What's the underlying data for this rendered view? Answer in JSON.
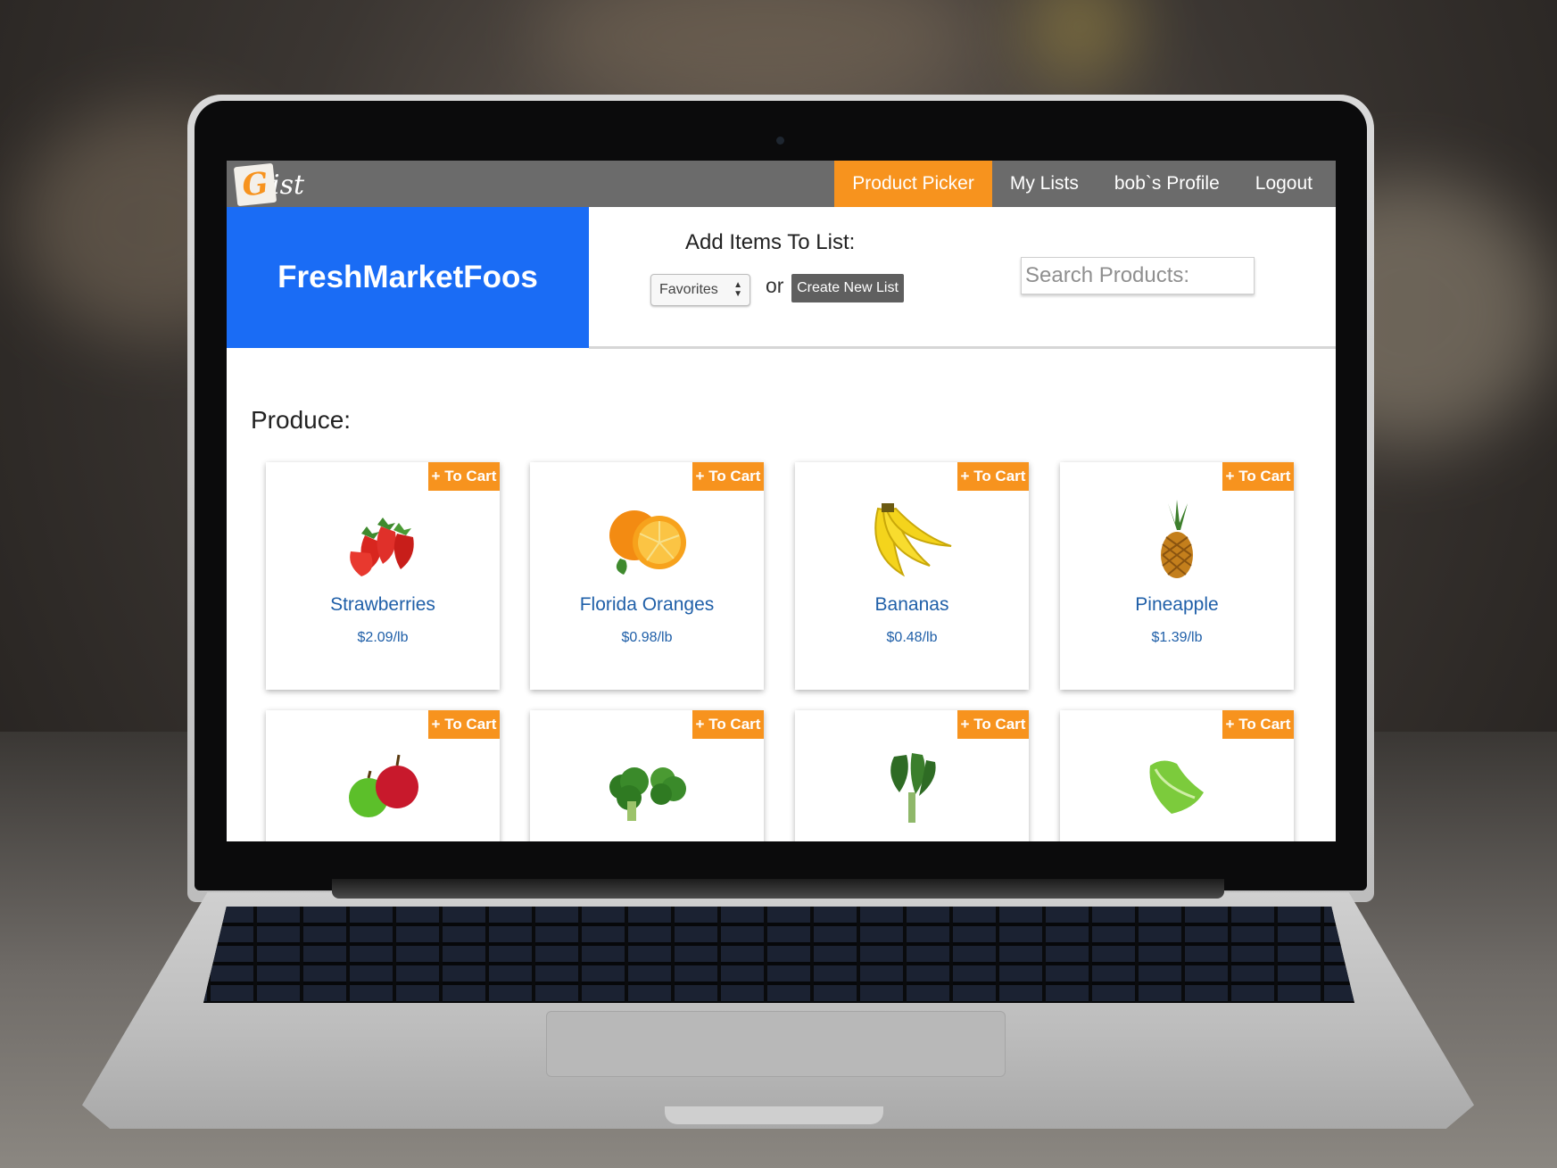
{
  "app": {
    "logo_first_letter": "G",
    "logo_rest": "ist",
    "brand_name": "FreshMarketFoos"
  },
  "nav": {
    "items": [
      {
        "label": "Product Picker",
        "active": true
      },
      {
        "label": "My Lists",
        "active": false
      },
      {
        "label": "bob`s Profile",
        "active": false
      },
      {
        "label": "Logout",
        "active": false
      }
    ]
  },
  "toolbar": {
    "add_items_label": "Add Items To List:",
    "list_select_value": "Favorites",
    "or_text": "or",
    "create_list_label": "Create New List",
    "search_placeholder": "Search Products:"
  },
  "section": {
    "title": "Produce:"
  },
  "products": [
    {
      "name": "Strawberries",
      "price": "$2.09/lb",
      "cart_label": "+ To Cart",
      "icon": "strawberry-icon"
    },
    {
      "name": "Florida Oranges",
      "price": "$0.98/lb",
      "cart_label": "+ To Cart",
      "icon": "orange-icon"
    },
    {
      "name": "Bananas",
      "price": "$0.48/lb",
      "cart_label": "+ To Cart",
      "icon": "banana-icon"
    },
    {
      "name": "Pineapple",
      "price": "$1.39/lb",
      "cart_label": "+ To Cart",
      "icon": "pineapple-icon"
    },
    {
      "name": "",
      "price": "",
      "cart_label": "+ To Cart",
      "icon": "apple-icon"
    },
    {
      "name": "",
      "price": "",
      "cart_label": "+ To Cart",
      "icon": "broccoli-icon"
    },
    {
      "name": "",
      "price": "",
      "cart_label": "+ To Cart",
      "icon": "kale-icon"
    },
    {
      "name": "",
      "price": "",
      "cart_label": "+ To Cart",
      "icon": "lettuce-icon"
    }
  ],
  "colors": {
    "accent": "#f7931e",
    "brand_blue": "#1a6cf5",
    "nav_gray": "#6b6b6b",
    "link_blue": "#1f5fa8"
  }
}
